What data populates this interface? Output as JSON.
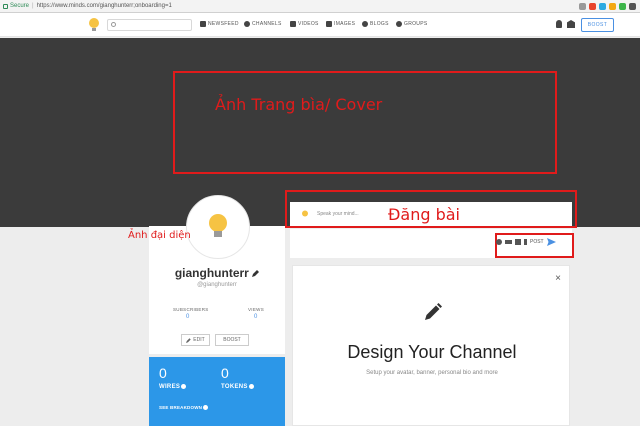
{
  "browser": {
    "secure_label": "Secure",
    "url": "https://www.minds.com/gianghunterr;onboarding=1"
  },
  "nav": {
    "search_placeholder": "",
    "items": [
      {
        "label": "NEWSFEED",
        "icon": "home-icon"
      },
      {
        "label": "CHANNELS",
        "icon": "people-icon"
      },
      {
        "label": "VIDEOS",
        "icon": "video-icon"
      },
      {
        "label": "IMAGES",
        "icon": "image-icon"
      },
      {
        "label": "BLOGS",
        "icon": "blog-icon"
      },
      {
        "label": "GROUPS",
        "icon": "groups-icon"
      }
    ],
    "boost_label": "BOOST"
  },
  "annotations": {
    "cover": "Ảnh Trang bìa/ Cover",
    "post": "Đăng bài",
    "avatar": "Ảnh đại diện"
  },
  "profile": {
    "username": "gianghunterr",
    "handle": "@gianghunterr",
    "subscribers_label": "SUBSCRIBERS",
    "subscribers_value": "0",
    "views_label": "VIEWS",
    "views_value": "0",
    "edit_label": "EDIT",
    "boost_label": "BOOST"
  },
  "wallet": {
    "wires_value": "0",
    "wires_label": "WIRES",
    "tokens_value": "0",
    "tokens_label": "TOKENS",
    "breakdown_label": "SEE BREAKDOWN"
  },
  "composer": {
    "placeholder": "Speak your mind...",
    "post_label": "POST"
  },
  "design_card": {
    "title": "Design Your Channel",
    "subtitle": "Setup your avatar, banner, personal bio and more",
    "close": "×"
  },
  "colors": {
    "accent": "#4a90e2",
    "wallet": "#2c97e8",
    "annotation": "#e01b1b",
    "banner": "#3b3b3b"
  }
}
